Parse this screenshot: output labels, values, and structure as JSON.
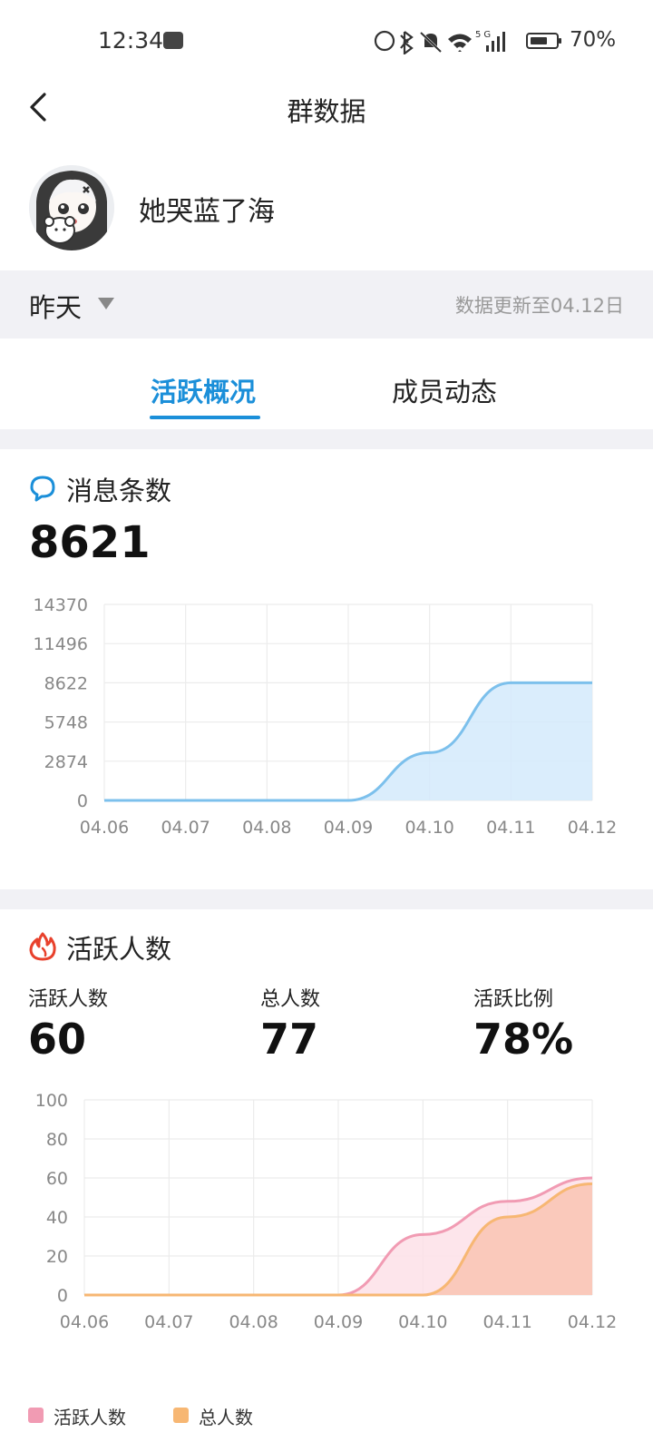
{
  "status_bar": {
    "time": "12:34",
    "battery_percent": "70%",
    "battery_level": 0.7,
    "network": "5G"
  },
  "nav": {
    "title": "群数据"
  },
  "group": {
    "name": "她哭蓝了海"
  },
  "filter": {
    "period": "昨天",
    "updated": "数据更新至04.12日"
  },
  "tabs": [
    {
      "label": "活跃概况",
      "active": true
    },
    {
      "label": "成员动态",
      "active": false
    }
  ],
  "messages": {
    "title": "消息条数",
    "value": "8621",
    "chart_data": {
      "type": "area",
      "categories": [
        "04.06",
        "04.07",
        "04.08",
        "04.09",
        "04.10",
        "04.11",
        "04.12"
      ],
      "y_ticks": [
        "14370",
        "11496",
        "8622",
        "5748",
        "2874",
        "0"
      ],
      "ylim": [
        0,
        14370
      ],
      "series": [
        {
          "values": [
            0,
            0,
            0,
            0,
            3500,
            8622,
            8621
          ],
          "color": "#7cc0ec",
          "fill": "#d4eafb"
        }
      ],
      "grid": true
    }
  },
  "active": {
    "title": "活跃人数",
    "stats": [
      {
        "label": "活跃人数",
        "value": "60"
      },
      {
        "label": "总人数",
        "value": "77"
      },
      {
        "label": "活跃比例",
        "value": "78%"
      }
    ],
    "chart_data": {
      "type": "area",
      "categories": [
        "04.06",
        "04.07",
        "04.08",
        "04.09",
        "04.10",
        "04.11",
        "04.12"
      ],
      "y_ticks": [
        "100",
        "80",
        "60",
        "40",
        "20",
        "0"
      ],
      "ylim": [
        0,
        100
      ],
      "series": [
        {
          "name": "活跃人数",
          "values": [
            0,
            0,
            0,
            0,
            31,
            48,
            60
          ],
          "color": "#f19bb3",
          "fill": "#fde0e8"
        },
        {
          "name": "总人数",
          "values": [
            0,
            0,
            0,
            0,
            0,
            40,
            57
          ],
          "color": "#f7b773",
          "fill": "#f9c4b3"
        }
      ],
      "grid": true,
      "legend": "bottom-left"
    }
  }
}
